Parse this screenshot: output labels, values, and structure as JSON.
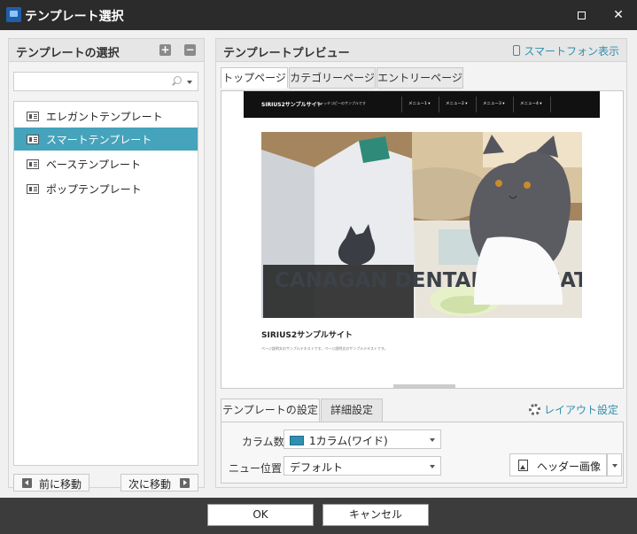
{
  "window": {
    "title": "テンプレート選択"
  },
  "left_panel": {
    "title": "テンプレートの選択",
    "add_label": "+",
    "remove_label": "−",
    "search": {
      "value": "",
      "placeholder": ""
    },
    "templates": [
      {
        "label": "エレガントテンプレート",
        "selected": false
      },
      {
        "label": "スマートテンプレート",
        "selected": true
      },
      {
        "label": "ベーステンプレート",
        "selected": false
      },
      {
        "label": "ポップテンプレート",
        "selected": false
      }
    ],
    "prev_label": "前に移動",
    "next_label": "次に移動"
  },
  "right_panel": {
    "title": "テンプレートプレビュー",
    "phone_view_label": "スマートフォン表示",
    "tabs": [
      "トップページ",
      "カテゴリーページ",
      "エントリーページ"
    ],
    "active_tab": 0,
    "preview": {
      "site_name": "SIRIUS2サンプルサイト",
      "catch_copy": "キャッチコピーのサンプルです",
      "menus": [
        "メニュー1 ▾",
        "メニュー2 ▾",
        "メニュー3 ▾",
        "メニュー4 ▾"
      ],
      "image_text": "CANAGAN DENTAL FOR CATS",
      "post_title": "SIRIUS2サンプルサイト",
      "post_text": "ページ説明文のサンプルテキストです。ページ説明文のサンプルテキストです。"
    },
    "settings_tabs": [
      "テンプレートの設定",
      "詳細設定"
    ],
    "layout_settings_label": "レイアウト設定",
    "column_label": "カラム数",
    "column_value": "1カラム(ワイド)",
    "menu_position_label": "ニュー位置",
    "menu_position_value": "デフォルト",
    "header_image_label": "ヘッダー画像"
  },
  "footer": {
    "ok_label": "OK",
    "cancel_label": "キャンセル"
  },
  "colors": {
    "accent": "#45a3bb",
    "link": "#2f8fae",
    "titlebar": "#2b2b2b",
    "footer": "#3c3c3c"
  }
}
